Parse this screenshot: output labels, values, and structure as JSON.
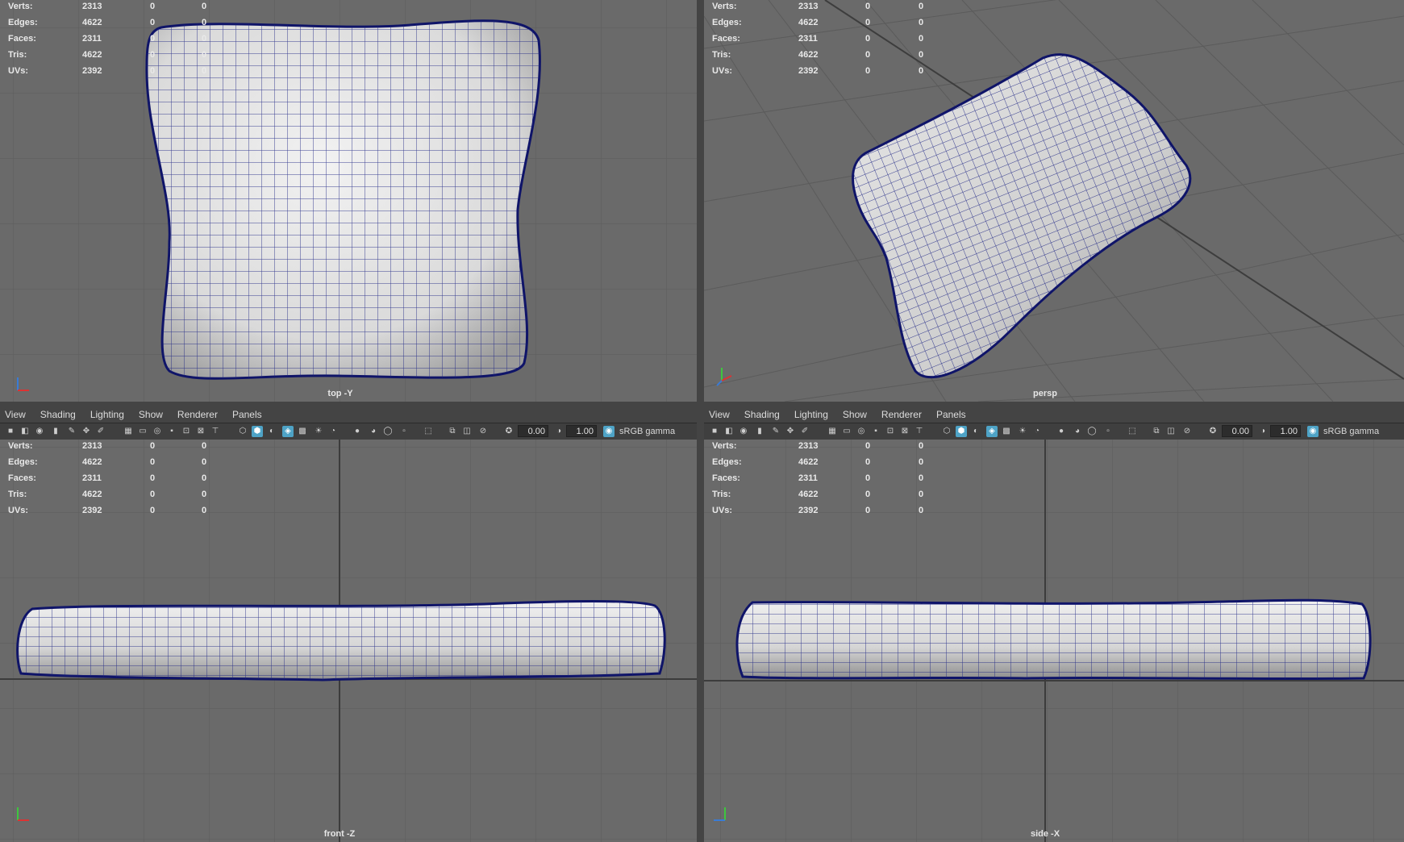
{
  "menus": [
    "View",
    "Shading",
    "Lighting",
    "Show",
    "Renderer",
    "Panels"
  ],
  "toolbar": {
    "exposure": "0.00",
    "gamma": "1.00",
    "color_space": "sRGB gamma"
  },
  "hud": {
    "rows": [
      {
        "label": "Verts:",
        "value": "2313",
        "c1": "0",
        "c2": "0"
      },
      {
        "label": "Edges:",
        "value": "4622",
        "c1": "0",
        "c2": "0"
      },
      {
        "label": "Faces:",
        "value": "2311",
        "c1": "0",
        "c2": "0"
      },
      {
        "label": "Tris:",
        "value": "4622",
        "c1": "0",
        "c2": "0"
      },
      {
        "label": "UVs:",
        "value": "2392",
        "c1": "0",
        "c2": "0"
      }
    ]
  },
  "viewports": {
    "top": {
      "camera": "top -Y"
    },
    "persp": {
      "camera": "persp"
    },
    "front": {
      "camera": "front -Z"
    },
    "side": {
      "camera": "side -X"
    }
  },
  "colors": {
    "viewport_bg": "#6a6a6a",
    "grid_line": "#5a5a5a",
    "grid_axis": "#3c3c3c",
    "wire": "#141a7a",
    "mesh": "#d9d9d9",
    "accent": "#4ea3c6"
  }
}
